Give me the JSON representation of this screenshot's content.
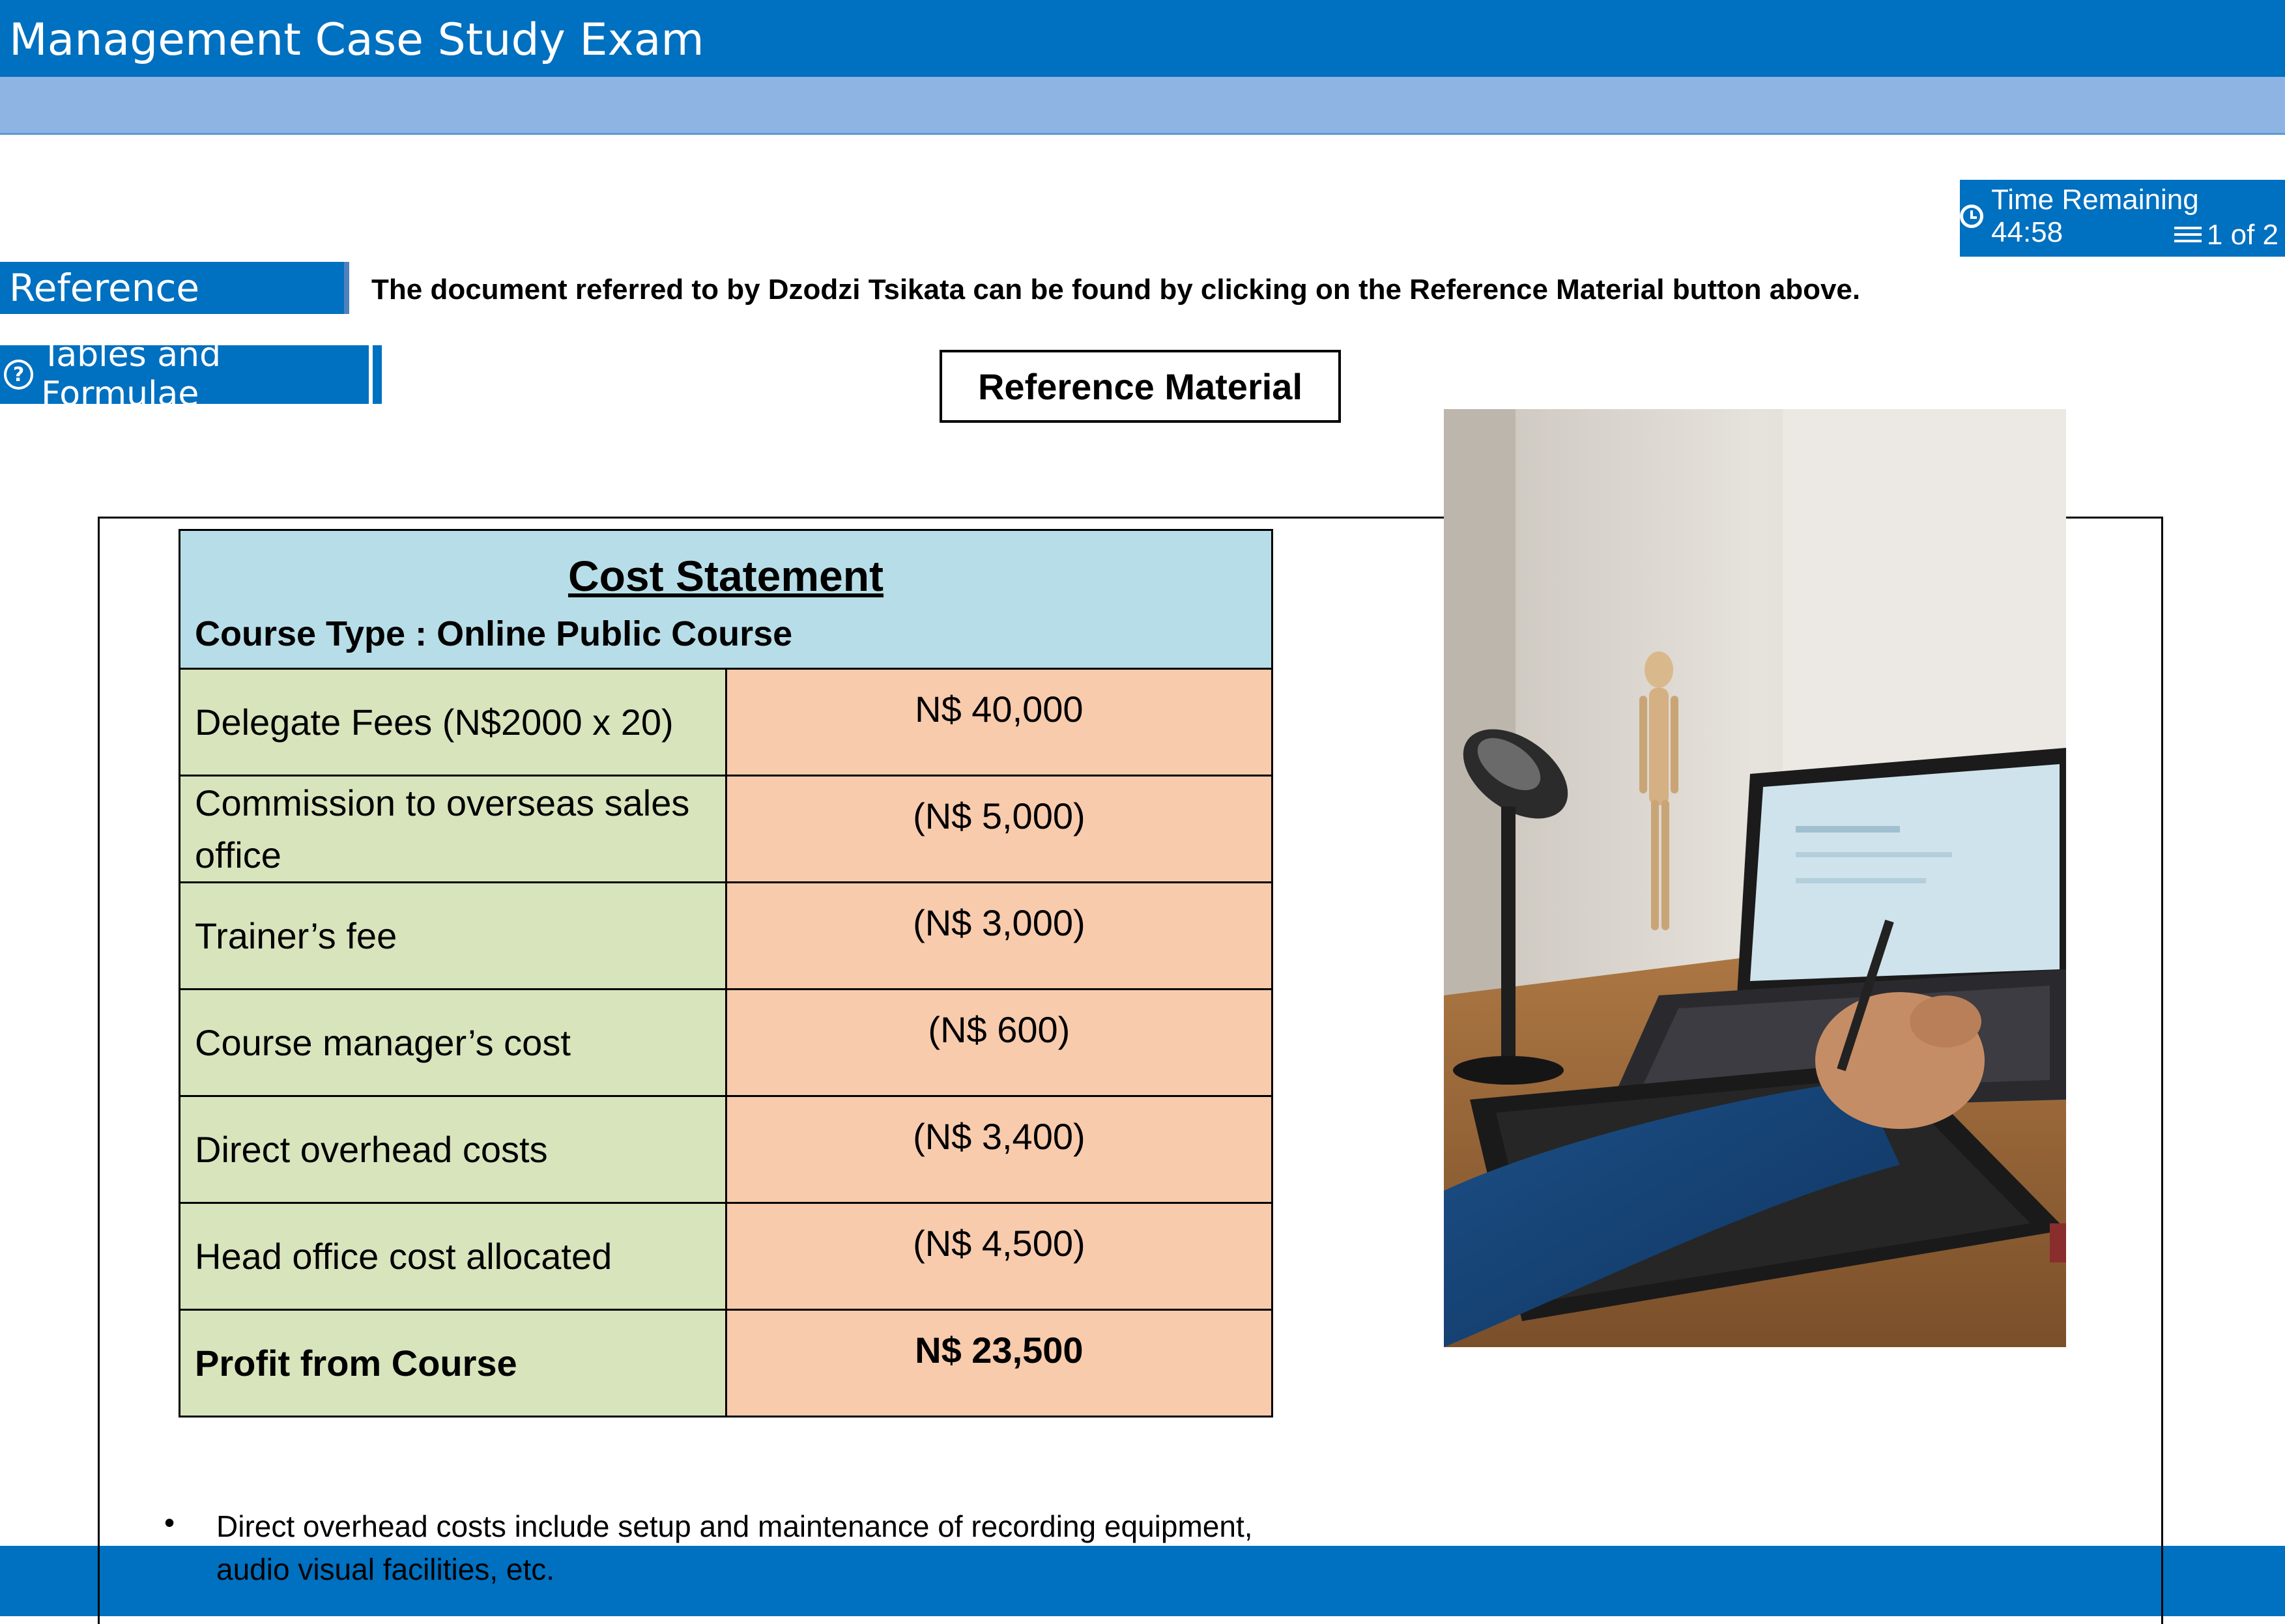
{
  "app": {
    "title": "Management Case Study Exam"
  },
  "timer": {
    "label": "Time Remaining 44:58",
    "page": "1 of 2"
  },
  "reference_button": {
    "label": "Reference Material"
  },
  "reference_note": "The document referred to by Dzodzi Tsikata can be found by clicking on the Reference Material button above.",
  "tables_button": {
    "label": "Tables and Formulae"
  },
  "reference_title": "Reference Material",
  "cost_statement": {
    "title": "Cost Statement",
    "subtitle": "Course Type : Online Public Course",
    "rows": [
      {
        "label": "Delegate Fees (N$2000 x 20)",
        "value": "N$ 40,000"
      },
      {
        "label": "Commission to overseas sales office",
        "value": "(N$ 5,000)"
      },
      {
        "label": "Trainer’s fee",
        "value": "(N$ 3,000)"
      },
      {
        "label": "Course manager’s cost",
        "value": "(N$ 600)"
      },
      {
        "label": "Direct overhead costs",
        "value": "(N$ 3,400)"
      },
      {
        "label": "Head office cost allocated",
        "value": "(N$ 4,500)"
      },
      {
        "label": "Profit from Course",
        "value": "N$ 23,500"
      }
    ]
  },
  "notes": [
    "Direct overhead costs include setup and maintenance of recording equipment, audio visual facilities, etc."
  ],
  "colors": {
    "brand": "#0070C0",
    "subbar": "#8DB4E2",
    "header_cell": "#B7DEE8",
    "label_cell": "#D8E4BC",
    "value_cell": "#F8CBAD"
  }
}
